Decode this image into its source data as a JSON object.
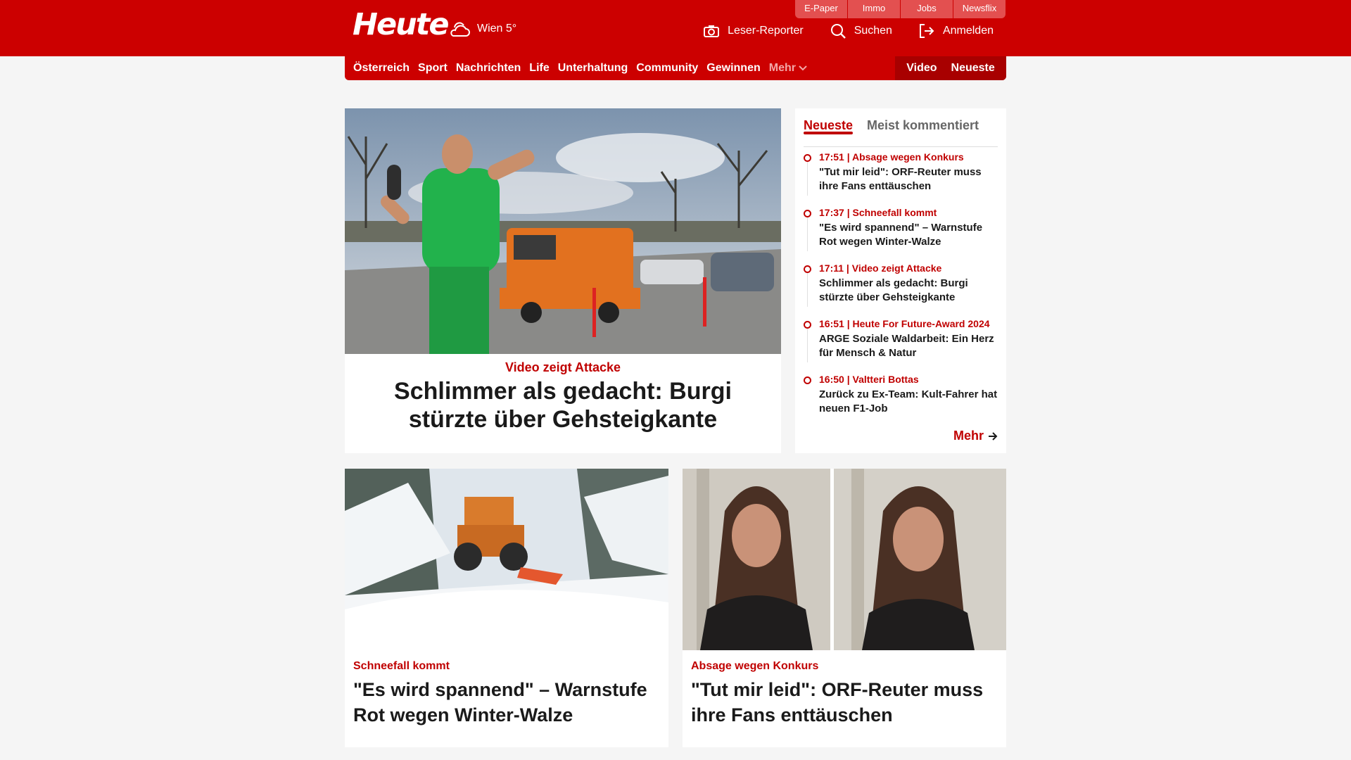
{
  "topbar": [
    "E-Paper",
    "Immo",
    "Jobs",
    "Newsflix"
  ],
  "logo": "Heute",
  "weather": {
    "text": "Wien 5°",
    "icon": "cloud-sun-icon"
  },
  "header_actions": [
    {
      "label": "Leser-Reporter",
      "icon": "camera-icon"
    },
    {
      "label": "Suchen",
      "icon": "search-icon"
    },
    {
      "label": "Anmelden",
      "icon": "login-icon"
    }
  ],
  "nav": {
    "items": [
      "Österreich",
      "Sport",
      "Nachrichten",
      "Life",
      "Unterhaltung",
      "Community",
      "Gewinnen"
    ],
    "more": "Mehr",
    "right": [
      "Video",
      "Neueste"
    ]
  },
  "hero": {
    "kicker": "Video zeigt Attacke",
    "title": "Schlimmer als gedacht: Burgi stürzte über Gehsteigkante"
  },
  "sidebar": {
    "tabs": [
      "Neueste",
      "Meist kommentiert"
    ],
    "items": [
      {
        "meta": "17:51 | Absage wegen Konkurs",
        "headline": "\"Tut mir leid\": ORF-Reuter muss ihre Fans enttäuschen"
      },
      {
        "meta": "17:37 | Schneefall kommt",
        "headline": "\"Es wird spannend\" – Warnstufe Rot wegen Winter-Walze"
      },
      {
        "meta": "17:11 | Video zeigt Attacke",
        "headline": "Schlimmer als gedacht: Burgi stürzte über Gehsteigkante"
      },
      {
        "meta": "16:51 | Heute For Future-Award 2024",
        "headline": "ARGE Soziale Waldarbeit: Ein Herz für Mensch & Natur"
      },
      {
        "meta": "16:50 | Valtteri Bottas",
        "headline": "Zurück zu Ex-Team: Kult-Fahrer hat neuen F1-Job"
      }
    ],
    "more": "Mehr"
  },
  "cards": [
    {
      "kicker": "Schneefall kommt",
      "title": "\"Es wird spannend\" – Warnstufe Rot wegen Winter-Walze"
    },
    {
      "kicker": "Absage wegen Konkurs",
      "title": "\"Tut mir leid\": ORF-Reuter muss ihre Fans enttäuschen"
    }
  ],
  "colors": {
    "brand": "#cc0000",
    "brand_dark": "#a80000",
    "background": "#f5f5f5"
  }
}
